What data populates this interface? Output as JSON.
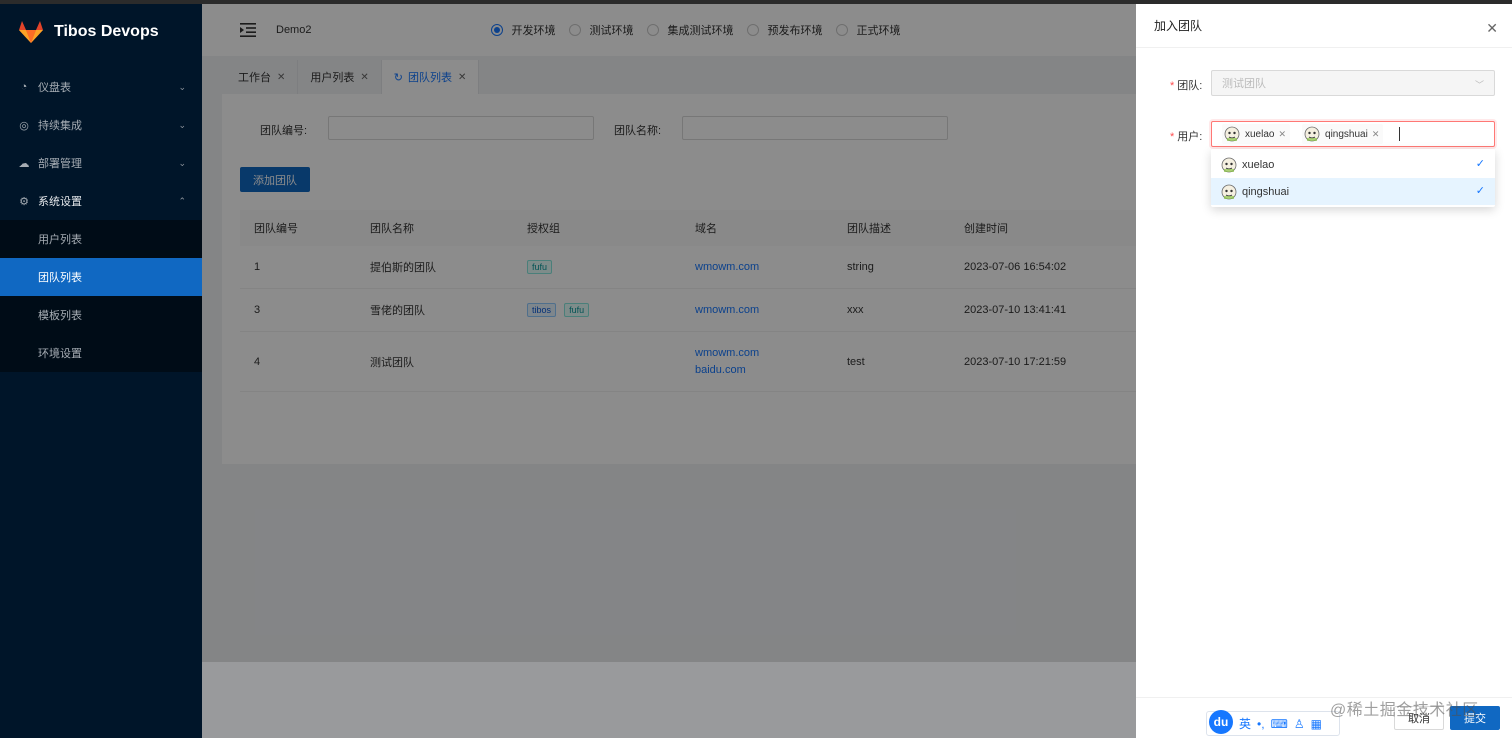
{
  "sidebar": {
    "title": "Tibos Devops",
    "menu": [
      {
        "label": "仪盘表",
        "icon": "dashboard-icon"
      },
      {
        "label": "持续集成",
        "icon": "ci-icon"
      },
      {
        "label": "部署管理",
        "icon": "cloud-icon"
      },
      {
        "label": "系统设置",
        "icon": "settings-icon"
      }
    ],
    "submenu": [
      "用户列表",
      "团队列表",
      "模板列表",
      "环境设置"
    ],
    "active_sub": "团队列表"
  },
  "header": {
    "app_name": "Demo2",
    "envs": [
      {
        "label": "开发环境",
        "checked": true
      },
      {
        "label": "测试环境",
        "checked": false
      },
      {
        "label": "集成测试环境",
        "checked": false
      },
      {
        "label": "预发布环境",
        "checked": false
      },
      {
        "label": "正式环境",
        "checked": false
      }
    ]
  },
  "tabs": [
    {
      "label": "工作台"
    },
    {
      "label": "用户列表"
    },
    {
      "label": "团队列表",
      "active": true
    }
  ],
  "search": {
    "team_id_label": "团队编号:",
    "team_name_label": "团队名称:"
  },
  "add_button": "添加团队",
  "table": {
    "headers": [
      "团队编号",
      "团队名称",
      "授权组",
      "域名",
      "团队描述",
      "创建时间"
    ],
    "rows": [
      {
        "id": "1",
        "name": "提伯斯的团队",
        "groups": [
          "fufu"
        ],
        "domains": [
          "wmowm.com"
        ],
        "desc": "string",
        "time": "2023-07-06 16:54:02"
      },
      {
        "id": "3",
        "name": "雪佬的团队",
        "groups": [
          "tibos",
          "fufu"
        ],
        "domains": [
          "wmowm.com"
        ],
        "desc": "xxx",
        "time": "2023-07-10 13:41:41"
      },
      {
        "id": "4",
        "name": "测试团队",
        "groups": [],
        "domains": [
          "wmowm.com",
          "baidu.com"
        ],
        "desc": "test",
        "time": "2023-07-10 17:21:59"
      }
    ]
  },
  "drawer": {
    "title": "加入团队",
    "team_label": "团队:",
    "team_value": "测试团队",
    "user_label": "用户:",
    "selected_users": [
      "xuelao",
      "qingshuai"
    ],
    "options": [
      {
        "label": "xuelao",
        "selected": true
      },
      {
        "label": "qingshuai",
        "selected": true
      }
    ],
    "cancel": "取消",
    "submit": "提交"
  },
  "ime": {
    "logo": "du",
    "lang": "英"
  },
  "watermark": "@稀土掘金技术社区",
  "colors": {
    "sidebar_bg": "#001529",
    "primary": "#1068c2",
    "link": "#1677ff",
    "tag_green": "#08979c",
    "required": "#ff4d4f"
  }
}
